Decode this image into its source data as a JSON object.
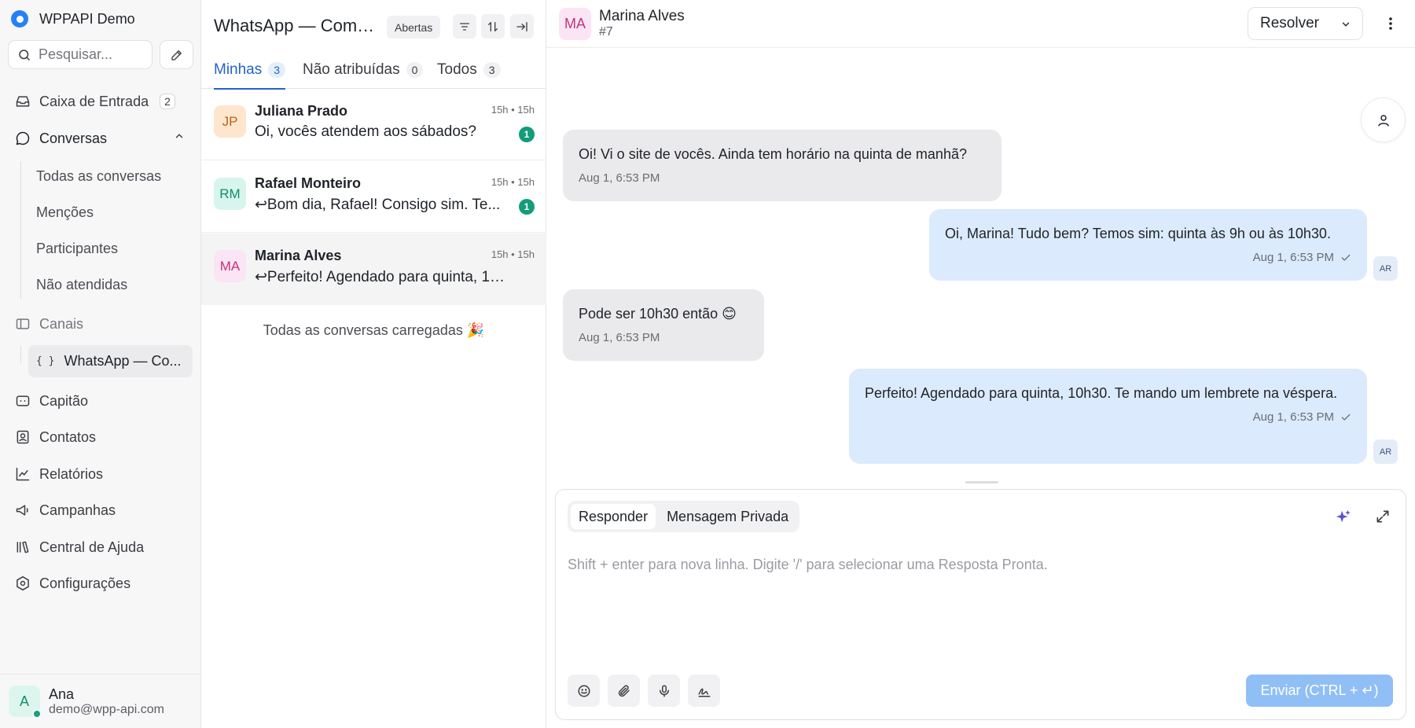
{
  "sidebar": {
    "brand": "WPPAPI Demo",
    "search_placeholder": "Pesquisar...",
    "inbox": {
      "label": "Caixa de Entrada",
      "count": "2"
    },
    "conversations": {
      "label": "Conversas",
      "children": [
        "Todas as conversas",
        "Menções",
        "Participantes",
        "Não atendidas"
      ]
    },
    "channels": {
      "label": "Canais",
      "active_channel": "WhatsApp — Co...",
      "channel_icon": "{ }"
    },
    "items": [
      "Capitão",
      "Contatos",
      "Relatórios",
      "Campanhas",
      "Central de Ajuda",
      "Configurações"
    ],
    "user": {
      "initial": "A",
      "name": "Ana",
      "email": "demo@wpp-api.com"
    }
  },
  "list": {
    "title": "WhatsApp — Come...",
    "filter": "Abertas",
    "tabs": [
      {
        "label": "Minhas",
        "count": "3"
      },
      {
        "label": "Não atribuídas",
        "count": "0"
      },
      {
        "label": "Todos",
        "count": "3"
      }
    ],
    "conversations": [
      {
        "initials": "JP",
        "name": "Juliana Prado",
        "time": "15h • 15h",
        "message": "Oi, vocês atendem aos sábados?",
        "unread": "1"
      },
      {
        "initials": "RM",
        "name": "Rafael Monteiro",
        "time": "15h • 15h",
        "message": "↩Bom dia, Rafael! Consigo sim. Te...",
        "unread": "1"
      },
      {
        "initials": "MA",
        "name": "Marina Alves",
        "time": "15h • 15h",
        "message": "↩Perfeito! Agendado para quinta, 10h..."
      }
    ],
    "footer_note": "Todas as conversas carregadas 🎉"
  },
  "chat": {
    "contact": {
      "initials": "MA",
      "name": "Marina Alves",
      "id": "#7"
    },
    "resolve_label": "Resolver",
    "agent_initials": "AR",
    "messages": [
      {
        "direction": "in",
        "text": "Oi! Vi o site de vocês. Ainda tem horário na quinta de manhã?",
        "time": "Aug 1, 6:53 PM"
      },
      {
        "direction": "out",
        "text": "Oi, Marina! Tudo bem? Temos sim: quinta às 9h ou às 10h30.",
        "time": "Aug 1, 6:53 PM"
      },
      {
        "direction": "in",
        "text": "Pode ser 10h30 então 😊",
        "time": "Aug 1, 6:53 PM"
      },
      {
        "direction": "out",
        "text": "Perfeito! Agendado para quinta, 10h30. Te mando um lembrete na véspera.",
        "time": "Aug 1, 6:53 PM"
      }
    ],
    "composer": {
      "reply_label": "Responder",
      "private_label": "Mensagem Privada",
      "placeholder": "Shift + enter para nova linha. Digite '/' para selecionar uma Resposta Pronta.",
      "send_label": "Enviar (CTRL + ↵)"
    }
  },
  "colors": {
    "accent": "#2563c9",
    "unread_badge": "#139b7a",
    "outgoing_bubble": "#dbeafd",
    "incoming_bubble": "#eaeaec",
    "send_button": "#90bff6"
  }
}
